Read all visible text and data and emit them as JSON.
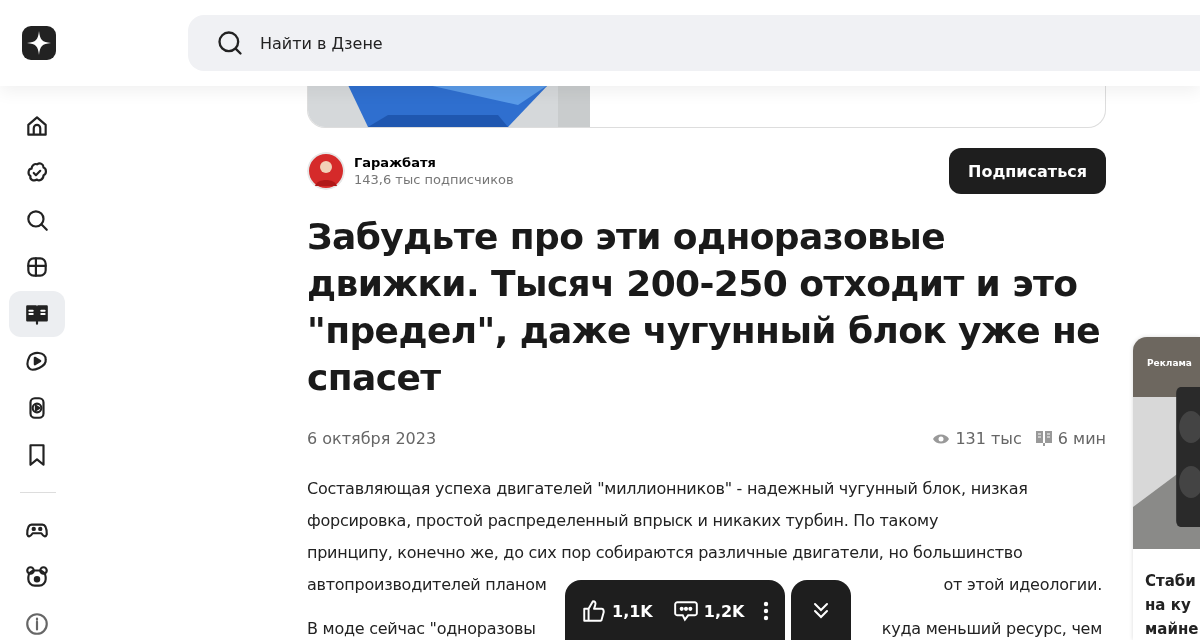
{
  "header": {
    "search": {
      "placeholder": "Найти в Дзене"
    }
  },
  "sidebar": {
    "items": [
      {
        "selected": false
      },
      {
        "selected": false
      },
      {
        "selected": false
      },
      {
        "selected": false
      },
      {
        "selected": true
      },
      {
        "selected": false
      },
      {
        "selected": false
      },
      {
        "selected": false
      }
    ],
    "extra_items": [
      {
        "selected": false
      },
      {
        "selected": false
      },
      {
        "selected": false
      }
    ]
  },
  "article": {
    "author": {
      "name": "Гаражбатя",
      "subscribers": "143,6 тыс подписчиков"
    },
    "subscribe_button": "Подписаться",
    "title": "Забудьте про эти одноразовые движки. Тысяч 200-250 отходит и это \"предел\", даже чугунный блок уже не спасет",
    "date": "6 октября 2023",
    "views": "131 тыс",
    "read_time": "6 мин",
    "paragraph_lines": [
      "Составляющая успеха двигателей \"миллионников\" - надежный чугунный блок, низкая",
      "форсировка, простой распределенный впрыск и никаких турбин. По такому",
      "принципу, конечно же, до сих пор собираются различные двигатели, но большинство"
    ],
    "partial_lines": [
      {
        "left": "автопроизводителей планом",
        "right": "от этой идеологии."
      },
      {
        "left": "В моде сейчас \"одноразовы",
        "right": "куда меньший ресурс, чем"
      }
    ]
  },
  "action_bar": {
    "likes": "1,1K",
    "comments": "1,2K"
  },
  "ad_card": {
    "label": "Реклама",
    "title_lines": [
      "Стаби",
      "на ку",
      "майне"
    ]
  }
}
